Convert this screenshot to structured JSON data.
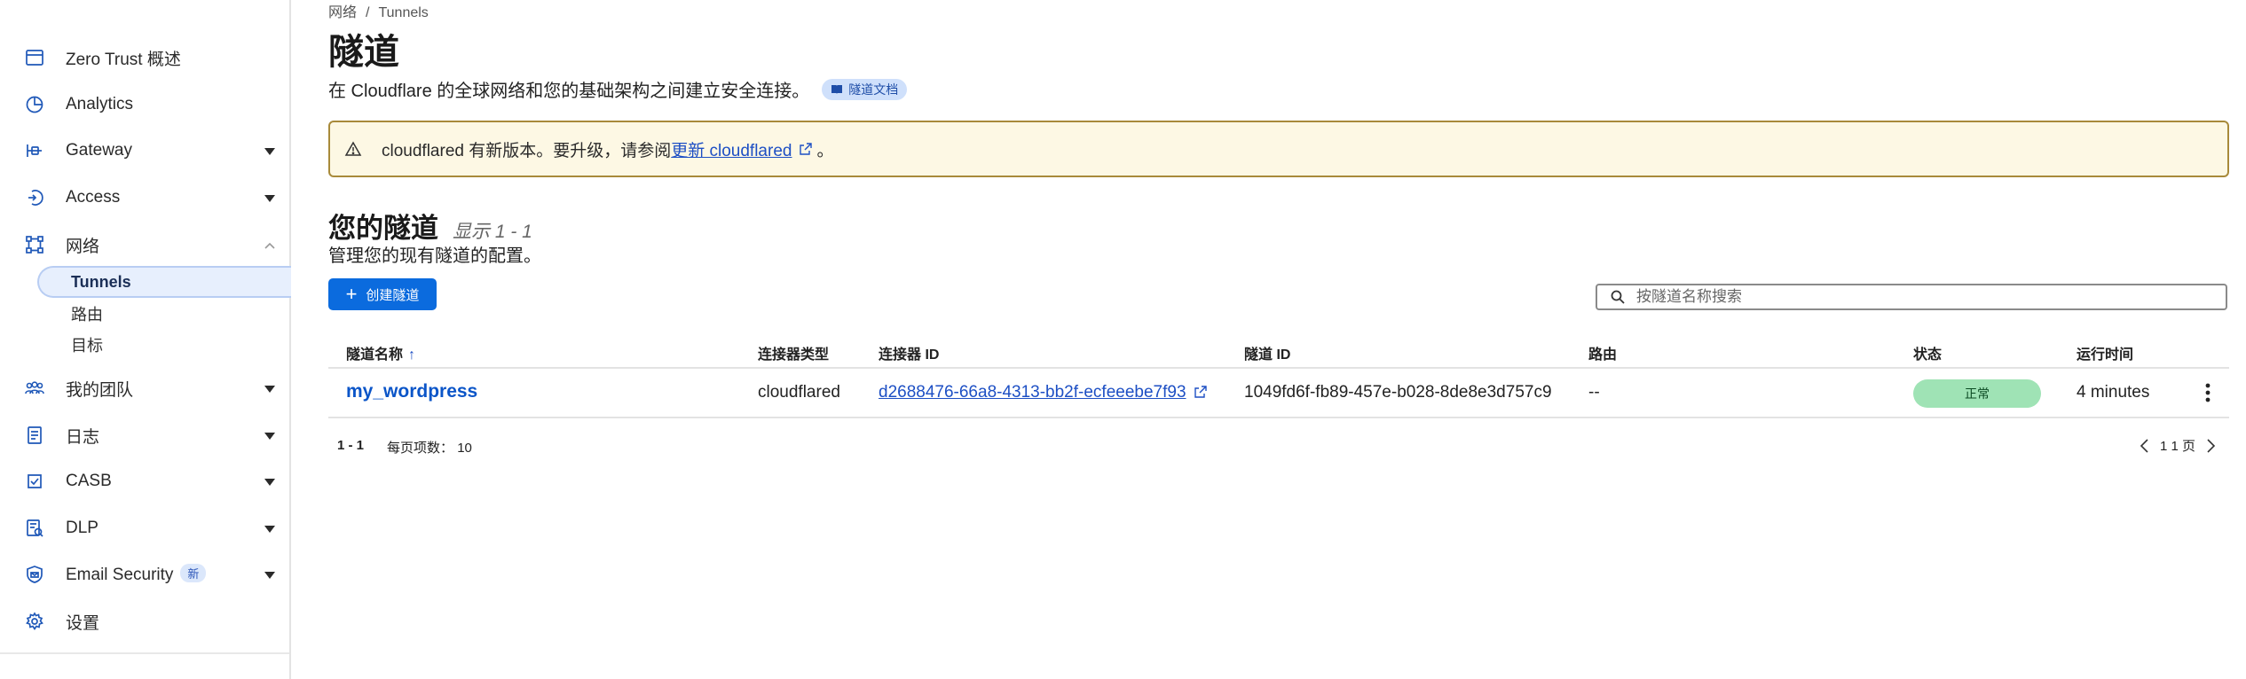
{
  "sidebar": {
    "items": [
      {
        "label": "Zero Trust 概述",
        "icon": "browser-window-icon"
      },
      {
        "label": "Analytics",
        "icon": "analytics-icon"
      },
      {
        "label": "Gateway",
        "icon": "gateway-icon"
      },
      {
        "label": "Access",
        "icon": "access-icon"
      },
      {
        "label": "网络",
        "icon": "network-icon"
      },
      {
        "label": "我的团队",
        "icon": "team-icon"
      },
      {
        "label": "日志",
        "icon": "logs-icon"
      },
      {
        "label": "CASB",
        "icon": "casb-icon"
      },
      {
        "label": "DLP",
        "icon": "dlp-icon"
      },
      {
        "label": "Email Security",
        "icon": "email-security-icon",
        "badge": "新"
      },
      {
        "label": "设置",
        "icon": "settings-gear-icon"
      }
    ],
    "network_sub": [
      {
        "label": "Tunnels",
        "active": true
      },
      {
        "label": "路由"
      },
      {
        "label": "目标"
      }
    ]
  },
  "breadcrumb": {
    "parent": "网络",
    "separator": "/",
    "current": "Tunnels"
  },
  "page": {
    "title": "隧道",
    "description": "在 Cloudflare 的全球网络和您的基础架构之间建立安全连接。",
    "docs_badge": "隧道文档"
  },
  "alert": {
    "text_before": "cloudflared 有新版本。要升级，请参阅",
    "link": "更新 cloudflared",
    "text_after": "。"
  },
  "tunnels_section": {
    "title": "您的隧道",
    "count": "显示 1 - 1",
    "description": "管理您的现有隧道的配置。",
    "create_button": "创建隧道",
    "search_placeholder": "按隧道名称搜索"
  },
  "table": {
    "headers": {
      "name": "隧道名称",
      "sort_indicator": "↑",
      "connector_type": "连接器类型",
      "connector_id": "连接器 ID",
      "tunnel_id": "隧道 ID",
      "routes": "路由",
      "status": "状态",
      "uptime": "运行时间"
    },
    "rows": [
      {
        "name": "my_wordpress",
        "connector_type": "cloudflared",
        "connector_id": "d2688476-66a8-4313-bb2f-ecfeeebe7f93",
        "tunnel_id": "1049fd6f-fb89-457e-b028-8de8e3d757c9",
        "routes": "--",
        "status": "正常",
        "uptime": "4 minutes"
      }
    ],
    "footer": {
      "range": "1 - 1",
      "per_page_label": "每页项数：",
      "per_page_value": "10",
      "page_info": "1 1 页"
    }
  },
  "colors": {
    "accent": "#0b6bde",
    "status_ok_bg": "#9fe3b5",
    "alert_bg": "#fdf8e4",
    "alert_border": "#a88a3a",
    "nav_icon": "#1f58b8"
  }
}
